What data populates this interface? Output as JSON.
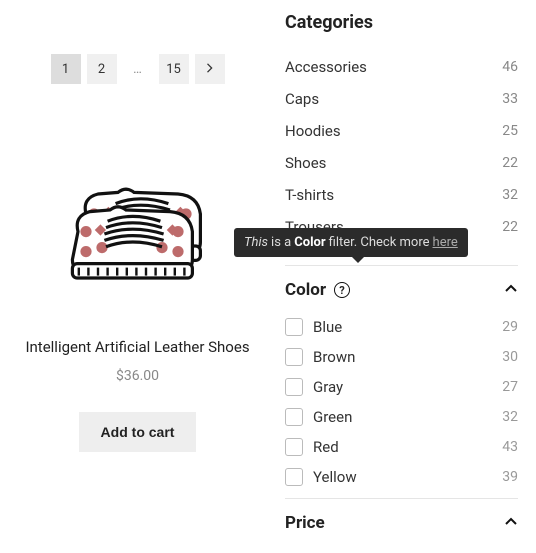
{
  "pagination": {
    "pages": [
      "1",
      "2",
      "…",
      "15"
    ],
    "current": 0
  },
  "product": {
    "title": "Intelligent Artificial Leather Shoes",
    "price": "$36.00",
    "button": "Add to cart"
  },
  "sidebar": {
    "categories_title": "Categories",
    "categories": [
      {
        "label": "Accessories",
        "count": "46"
      },
      {
        "label": "Caps",
        "count": "33"
      },
      {
        "label": "Hoodies",
        "count": "25"
      },
      {
        "label": "Shoes",
        "count": "22"
      },
      {
        "label": "T-shirts",
        "count": "32"
      },
      {
        "label": "Trousers",
        "count": "22"
      }
    ],
    "color_title": "Color",
    "colors": [
      {
        "label": "Blue",
        "count": "29"
      },
      {
        "label": "Brown",
        "count": "30"
      },
      {
        "label": "Gray",
        "count": "27"
      },
      {
        "label": "Green",
        "count": "32"
      },
      {
        "label": "Red",
        "count": "43"
      },
      {
        "label": "Yellow",
        "count": "39"
      }
    ],
    "price_title": "Price"
  },
  "tooltip": {
    "part1": "This",
    "part2": " is a ",
    "part3": "Color",
    "part4": " filter. Check more ",
    "link": "here"
  }
}
